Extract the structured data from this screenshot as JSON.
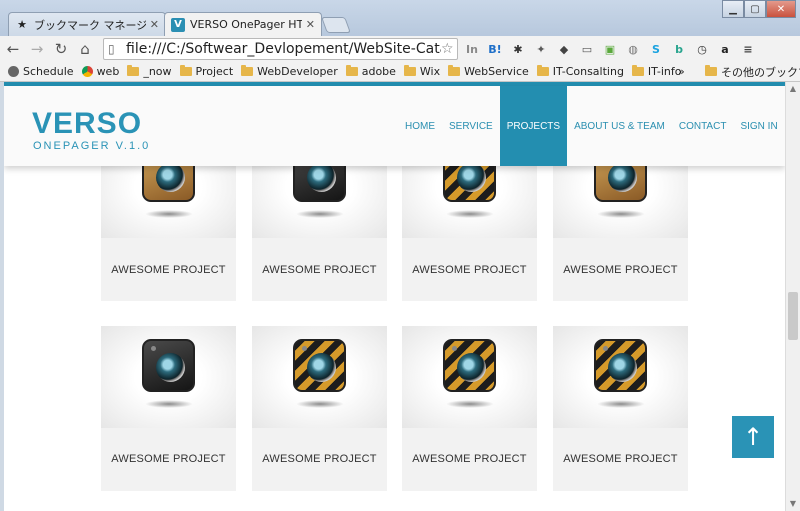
{
  "browser": {
    "tabs": [
      {
        "title": "ブックマーク マネージャ",
        "icon": "star-icon",
        "active": false
      },
      {
        "title": "VERSO OnePager HTML",
        "icon": "verso-favicon",
        "active": true
      }
    ],
    "close_glyph": "✕",
    "url": "file:///C:/Softwear_Devlopement/WebSite-Catalo",
    "extensions": [
      {
        "name": "in-ext",
        "label": "In",
        "color": "#8a8a8a"
      },
      {
        "name": "hatena-ext",
        "label": "B!",
        "color": "#1e6fc9"
      },
      {
        "name": "gear-ext",
        "label": "✱",
        "color": "#333"
      },
      {
        "name": "puzzle-ext",
        "label": "✦",
        "color": "#5a5a5a"
      },
      {
        "name": "pocket-ext",
        "label": "◆",
        "color": "#444"
      },
      {
        "name": "cast-ext",
        "label": "▭",
        "color": "#555"
      },
      {
        "name": "evernote-ext",
        "label": "▣",
        "color": "#5aa93c"
      },
      {
        "name": "globe-ext",
        "label": "◍",
        "color": "#777"
      },
      {
        "name": "skype-ext",
        "label": "S",
        "color": "#1aa3e0"
      },
      {
        "name": "b-ext",
        "label": "b",
        "color": "#2aa58f"
      },
      {
        "name": "clock-ext",
        "label": "◷",
        "color": "#333"
      },
      {
        "name": "amazon-ext",
        "label": "a",
        "color": "#222"
      },
      {
        "name": "menu-ext",
        "label": "≡",
        "color": "#444"
      }
    ],
    "bookmarks": [
      {
        "label": "Schedule",
        "kind": "apple"
      },
      {
        "label": "web",
        "kind": "chrome"
      },
      {
        "label": "_now",
        "kind": "folder"
      },
      {
        "label": "Project",
        "kind": "folder"
      },
      {
        "label": "WebDeveloper",
        "kind": "folder"
      },
      {
        "label": "adobe",
        "kind": "folder"
      },
      {
        "label": "Wix",
        "kind": "folder"
      },
      {
        "label": "WebService",
        "kind": "folder"
      },
      {
        "label": "IT-Consalting",
        "kind": "folder"
      },
      {
        "label": "IT-info",
        "kind": "folder"
      }
    ],
    "bookmarks_overflow": "»",
    "other_bookmarks": "その他のブックマーク"
  },
  "site": {
    "logo_title": "VERSO",
    "logo_subtitle": "ONEPAGER V.1.0",
    "nav": [
      {
        "label": "HOME",
        "active": false
      },
      {
        "label": "SERVICE",
        "active": false
      },
      {
        "label": "PROJECTS",
        "active": true
      },
      {
        "label": "ABOUT US & TEAM",
        "active": false
      },
      {
        "label": "CONTACT",
        "active": false
      },
      {
        "label": "SIGN IN",
        "active": false
      }
    ],
    "projects_row1": [
      {
        "caption": "AWESOME PROJECT",
        "style": "wood"
      },
      {
        "caption": "AWESOME PROJECT",
        "style": "black"
      },
      {
        "caption": "AWESOME PROJECT",
        "style": "hazard"
      },
      {
        "caption": "AWESOME PROJECT",
        "style": "wood"
      }
    ],
    "projects_row2": [
      {
        "caption": "AWESOME PROJECT",
        "style": "black"
      },
      {
        "caption": "AWESOME PROJECT",
        "style": "hazard"
      },
      {
        "caption": "AWESOME PROJECT",
        "style": "hazard"
      },
      {
        "caption": "AWESOME PROJECT",
        "style": "hazard"
      }
    ],
    "scroll_top_glyph": "↑",
    "accent_color": "#238eb0"
  }
}
